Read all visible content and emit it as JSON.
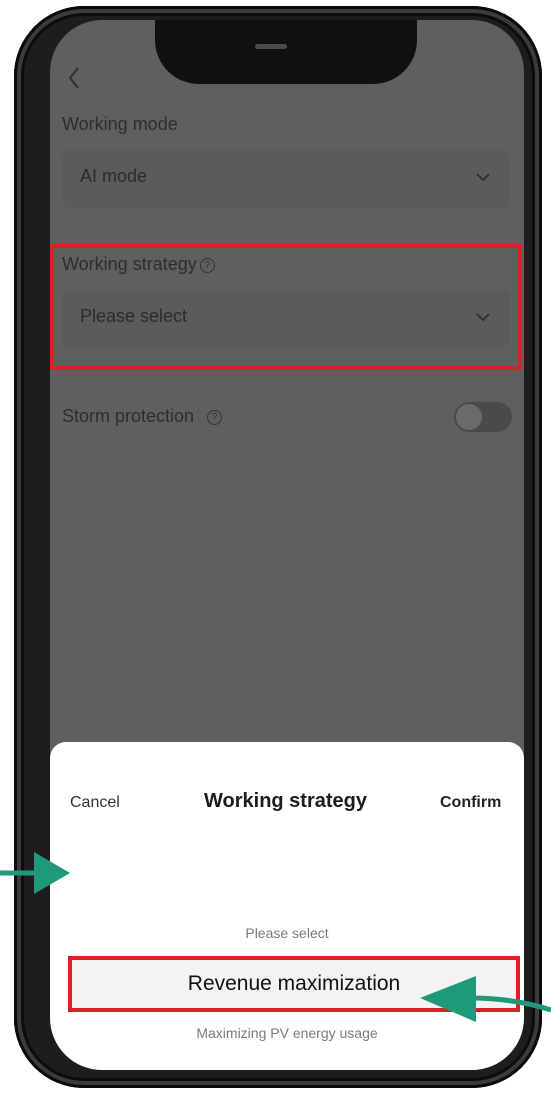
{
  "form": {
    "working_mode_label": "Working mode",
    "working_mode_value": "AI mode",
    "working_strategy_label": "Working strategy",
    "working_strategy_placeholder": "Please select",
    "storm_protection_label": "Storm protection",
    "storm_protection_on": false
  },
  "picker": {
    "cancel_label": "Cancel",
    "title": "Working strategy",
    "confirm_label": "Confirm",
    "options": [
      "Please select",
      "Revenue maximization",
      "Maximizing PV energy usage"
    ],
    "selected_option": "Revenue maximization"
  },
  "icons": {
    "back": "chevron-left-icon",
    "help": "help-circle-icon",
    "dropdown": "chevron-down-icon"
  },
  "colors": {
    "highlight": "#dd1f28",
    "arrow": "#1f9a78",
    "overlay": "#5f5f5f"
  }
}
